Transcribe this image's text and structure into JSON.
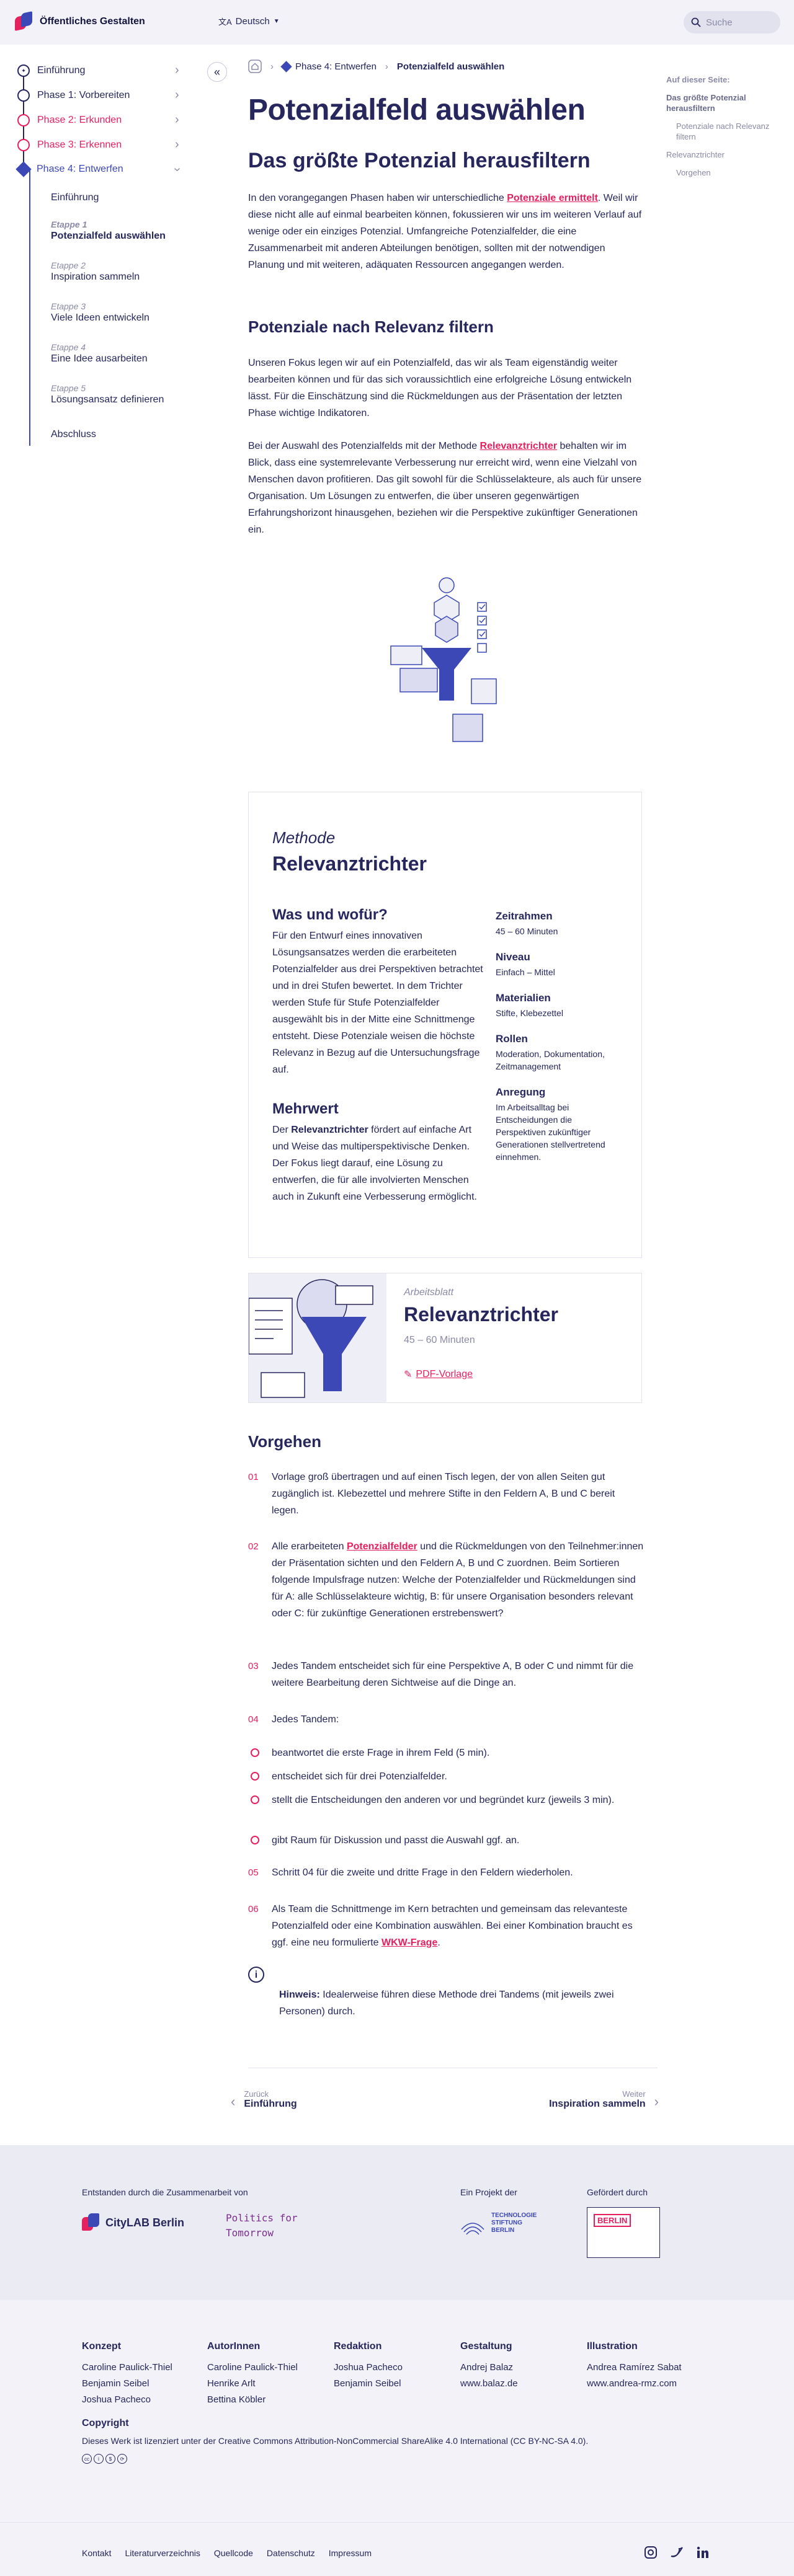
{
  "header": {
    "site_title": "Öffentliches Gestalten",
    "language": "Deutsch",
    "search_placeholder": "Suche"
  },
  "sidebar": {
    "phases": [
      {
        "label": "Einführung"
      },
      {
        "label": "Phase 1: Vorbereiten"
      },
      {
        "label": "Phase 2: Erkunden"
      },
      {
        "label": "Phase 3: Erkennen"
      },
      {
        "label": "Phase 4: Entwerfen"
      }
    ],
    "intro": "Einführung",
    "steps": [
      {
        "stage": "Etappe 1",
        "label": "Potenzialfeld auswählen"
      },
      {
        "stage": "Etappe 2",
        "label": "Inspiration sammeln"
      },
      {
        "stage": "Etappe 3",
        "label": "Viele Ideen entwickeln"
      },
      {
        "stage": "Etappe 4",
        "label": "Eine Idee ausarbeiten"
      },
      {
        "stage": "Etappe 5",
        "label": "Lösungsansatz definieren"
      }
    ],
    "closing": "Abschluss"
  },
  "breadcrumb": {
    "phase": "Phase 4: Entwerfen",
    "current": "Potenzialfeld auswählen"
  },
  "page_title": "Potenzialfeld auswählen",
  "section1": {
    "title": "Das größte Potenzial herausfiltern",
    "p_before": "In den vorangegangen Phasen haben wir unterschiedliche ",
    "p_link": "Potenziale ermittelt",
    "p_after": ". Weil wir diese nicht alle auf einmal bearbeiten können, fokussieren wir uns im weiteren Verlauf auf wenige oder ein einziges Potenzial. Umfangreiche Potenzialfelder, die eine Zusammenarbeit mit anderen Abteilungen benötigen, sollten mit der notwendigen Planung und mit weiteren, adäquaten Ressourcen angegangen werden."
  },
  "section2": {
    "title": "Potenziale nach Relevanz filtern",
    "p1": "Unseren Fokus legen wir auf ein Potenzialfeld, das wir als Team eigenständig weiter bearbeiten können und für das sich voraussichtlich eine erfolgreiche Lösung entwickeln lässt. Für die Einschätzung sind die Rückmeldungen aus der Präsentation der letzten Phase wichtige Indikatoren.",
    "p2_before": "Bei der Auswahl des Potenzialfelds mit der Methode ",
    "p2_link": "Relevanztrichter",
    "p2_after": " behalten wir im Blick, dass eine systemrelevante Verbesserung nur erreicht wird, wenn eine Vielzahl von Menschen davon profitieren. Das gilt sowohl für die Schlüsselakteure, als auch für unsere Organisation. Um Lösungen zu entwerfen, die über unseren gegenwärtigen Erfahrungshorizont hinausgehen, beziehen wir die Perspektive zukünftiger Generationen ein."
  },
  "toc": {
    "heading": "Auf dieser Seite:",
    "items": [
      "Das größte Potenzial herausfiltern",
      "Potenziale nach Relevanz filtern",
      "Relevanztrichter",
      "Vorgehen"
    ]
  },
  "method": {
    "kicker": "Methode",
    "title": "Relevanztrichter",
    "what_title": "Was und wofür?",
    "what_text": "Für den Entwurf eines innovativen Lösungsansatzes werden die erarbeiteten Potenzialfelder aus drei Perspektiven betrachtet und in drei Stufen bewertet. In dem Trichter werden Stufe für Stufe Potenzialfelder ausgewählt bis in der Mitte eine Schnittmenge entsteht. Diese Potenziale weisen die höchste Relevanz in Bezug auf die Untersuchungsfrage auf.",
    "value_title": "Mehrwert",
    "value_pre": "Der ",
    "value_bold": "Relevanztrichter",
    "value_text": " fördert auf einfache Art und Weise das multiperspektivische Denken. Der Fokus liegt darauf, eine Lösung zu entwerfen, die für alle involvierten Menschen auch in Zukunft eine Verbesserung ermöglicht.",
    "facts": [
      {
        "label": "Zeitrahmen",
        "value": "45 – 60 Minuten"
      },
      {
        "label": "Niveau",
        "value": "Einfach – Mittel"
      },
      {
        "label": "Materialien",
        "value": "Stifte, Klebezettel"
      },
      {
        "label": "Rollen",
        "value": "Moderation, Dokumentation, Zeitmanagement"
      },
      {
        "label": "Anregung",
        "value": "Im Arbeitsalltag bei Entscheidungen die Perspektiven zukünftiger Generationen stellvertretend einnehmen."
      }
    ]
  },
  "worksheet": {
    "kicker": "Arbeitsblatt",
    "title": "Relevanztrichter",
    "duration": "45 – 60 Minuten",
    "pdf": "PDF-Vorlage"
  },
  "procedure": {
    "title": "Vorgehen",
    "s01": "Vorlage groß übertragen und auf einen Tisch legen, der von allen Seiten gut zugänglich ist. Klebezettel und mehrere Stifte in den Feldern A, B und C bereit legen.",
    "s02_pre": "Alle erarbeiteten ",
    "s02_link": "Potenzialfelder",
    "s02_post": " und die Rückmeldungen von den Teilnehmer:innen der Präsentation sichten und den Feldern A, B und C zuordnen. Beim Sortieren folgende Impulsfrage nutzen: Welche der Potenzialfelder und Rückmeldungen sind für A: alle Schlüsselakteure wichtig, B: für unsere Organisation besonders relevant oder C: für zukünftige Generationen erstrebenswert?",
    "s03": "Jedes Tandem entscheidet sich für eine Perspektive A, B oder C und nimmt für die weitere Bearbeitung deren Sichtweise auf die Dinge an.",
    "s04": "Jedes Tandem:",
    "s04_items": [
      "beantwortet die erste Frage in ihrem Feld (5 min).",
      "entscheidet sich für drei Potenzialfelder.",
      "stellt die Entscheidungen den anderen vor und begründet kurz (jeweils 3 min).",
      "gibt Raum für Diskussion und passt die Auswahl ggf. an."
    ],
    "s05": "Schritt 04 für die zweite und dritte Frage in den Feldern wiederholen.",
    "s06_pre": "Als Team die Schnittmenge im Kern betrachten und gemeinsam das relevanteste Potenzialfeld oder eine Kombination auswählen. Bei einer Kombination braucht es ggf. eine neu formulierte ",
    "s06_link": "WKW-Frage",
    "s06_post": ".",
    "hint_label": "Hinweis:",
    "hint_text": " Idealerweise führen diese Methode drei Tandems (mit jeweils zwei Personen) durch.",
    "numbers": [
      "01",
      "02",
      "03",
      "04",
      "05",
      "06"
    ]
  },
  "pager": {
    "prev_label": "Zurück",
    "prev_title": "Einführung",
    "next_label": "Weiter",
    "next_title": "Inspiration sammeln"
  },
  "footer": {
    "collab_label": "Entstanden durch die Zusammenarbeit von",
    "citylab": "CityLAB Berlin",
    "pft": "Politics for Tomorrow",
    "project_label": "Ein Projekt der",
    "tsb": "TECHNOLOGIE STIFTUNG BERLIN",
    "funded_label": "Gefördert durch",
    "berlin": "BERLIN",
    "cols": [
      {
        "title": "Konzept",
        "names": [
          "Caroline Paulick-Thiel",
          "Benjamin Seibel",
          "Joshua Pacheco"
        ]
      },
      {
        "title": "AutorInnen",
        "names": [
          "Caroline Paulick-Thiel",
          "Henrike Arlt",
          "Bettina Köbler"
        ]
      },
      {
        "title": "Redaktion",
        "names": [
          "Joshua Pacheco",
          "Benjamin Seibel"
        ]
      },
      {
        "title": "Gestaltung",
        "names": [
          "Andrej Balaz",
          "www.balaz.de"
        ]
      },
      {
        "title": "Illustration",
        "names": [
          "Andrea Ramírez Sabat",
          "www.andrea-rmz.com"
        ]
      }
    ],
    "copyright_title": "Copyright",
    "copyright_text": "Dieses Werk ist lizenziert unter der Creative Commons Attribution-NonCommercial ShareAlike 4.0 International (CC BY-NC-SA 4.0).",
    "links": [
      "Kontakt",
      "Literaturverzeichnis",
      "Quellcode",
      "Datenschutz",
      "Impressum"
    ]
  }
}
